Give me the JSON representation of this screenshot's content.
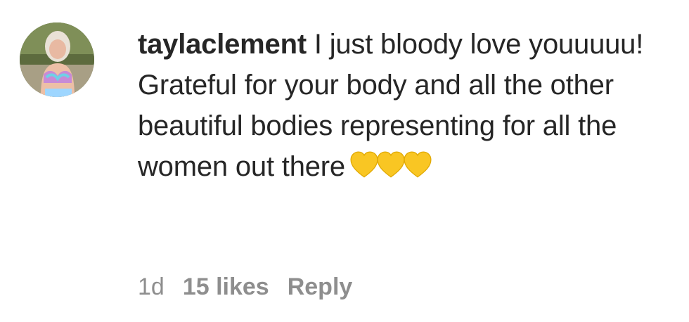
{
  "comment": {
    "username": "taylaclement",
    "text": "I just bloody love youuuuu! Grateful for your body and all the other beautiful bodies representing for all the women out there",
    "emoji": [
      "yellow-heart",
      "yellow-heart",
      "yellow-heart"
    ],
    "emoji_color": "#F9C623",
    "time": "1d",
    "likes": "15 likes",
    "reply_label": "Reply"
  },
  "colors": {
    "text": "#262626",
    "meta": "#8e8e8e"
  }
}
